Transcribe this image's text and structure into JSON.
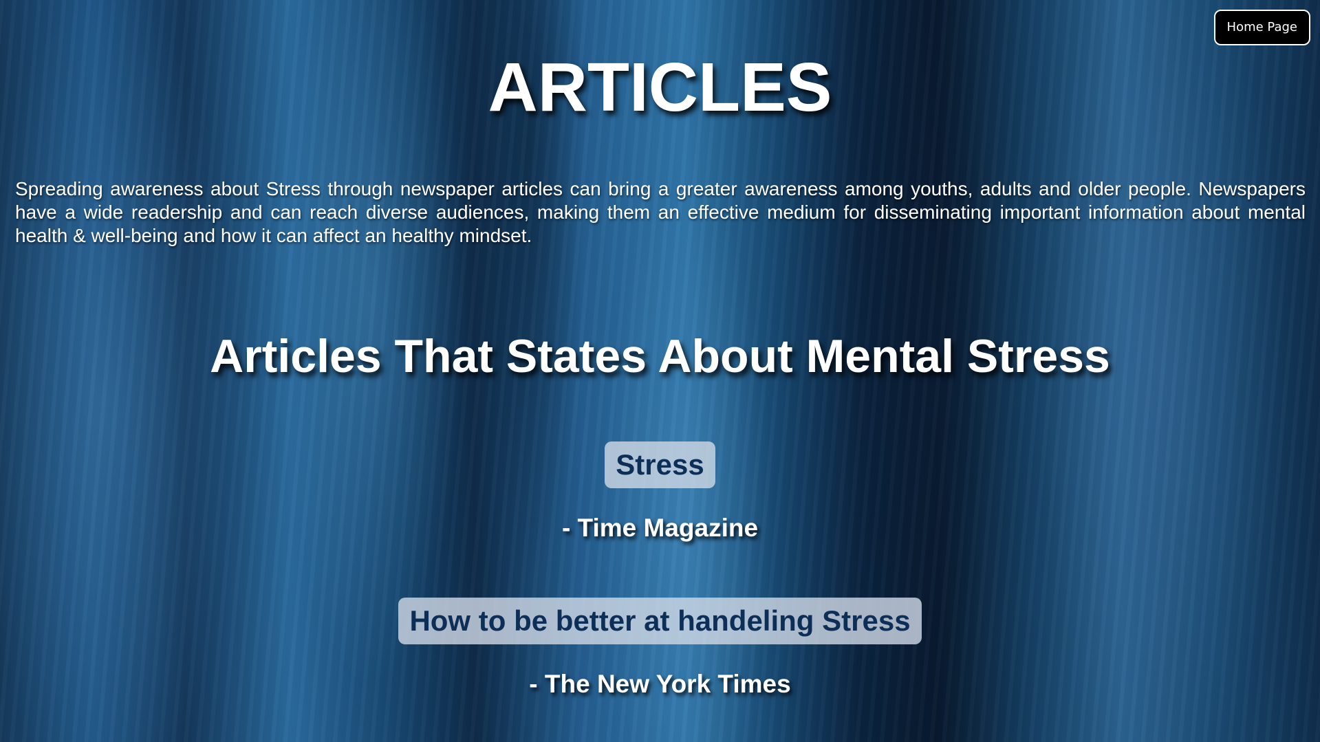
{
  "header": {
    "home_button_label": "Home Page"
  },
  "page": {
    "title": "ARTICLES",
    "intro": "Spreading awareness about Stress through newspaper articles can bring a greater awareness among youths, adults and older people. Newspapers have a wide readership and can reach diverse audiences, making them an effective medium for disseminating important information about mental health & well-being and how it can affect an healthy mindset.",
    "section_heading": "Articles That States About Mental Stress"
  },
  "articles": [
    {
      "title": "Stress",
      "source": "- Time Magazine"
    },
    {
      "title": "How to be better at handeling Stress",
      "source": "- The New York Times"
    }
  ],
  "colors": {
    "article_link_text": "#0d2f57",
    "article_link_bg": "#cdd7e4",
    "home_button_bg": "#000000",
    "text": "#ffffff"
  }
}
